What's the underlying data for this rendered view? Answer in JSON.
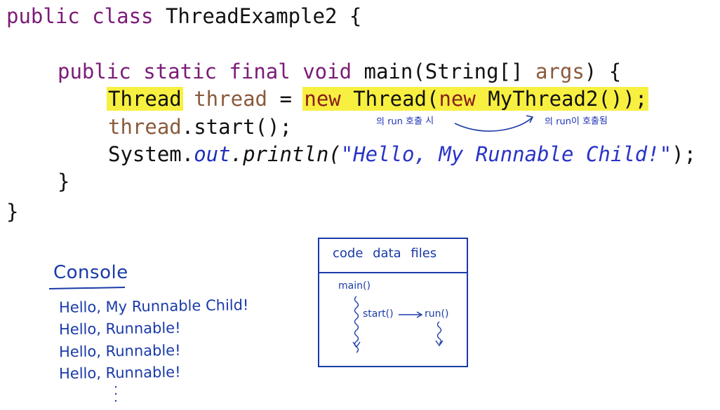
{
  "code": {
    "line1": {
      "kw": "public class",
      "rest": " ThreadExample2 {"
    },
    "line2": {
      "kw1": "public static final void",
      "mid": " main(String[] ",
      "param": "args",
      "end": ") {"
    },
    "line3": {
      "type": "Thread",
      "var": " thread",
      "assign": " = ",
      "new1": "new",
      "ctor": " Thread(",
      "new2": "new",
      "inner": " MyThread2());"
    },
    "line4": {
      "var": "thread",
      "rest": ".start();"
    },
    "line5": {
      "prefix": "System.",
      "field": "out",
      "method": ".println(",
      "string": "\"Hello, My Runnable Child!\"",
      "end": ");"
    },
    "line6": "}",
    "line7": "}"
  },
  "annotations": {
    "left": "의 run 호출 시",
    "right": "의 run이 호출됨"
  },
  "console": {
    "title": "Console",
    "lines": [
      "Hello, My Runnable Child!",
      "Hello, Runnable!",
      "Hello, Runnable!",
      "Hello, Runnable!"
    ]
  },
  "memory": {
    "header": "code data files",
    "main": "main()",
    "start": "start()",
    "run": "run()"
  },
  "colors": {
    "keyword": "#7b1b78",
    "variable": "#8a5a3c",
    "highlight": "#f8f040",
    "ink": "#1a3aa8"
  }
}
